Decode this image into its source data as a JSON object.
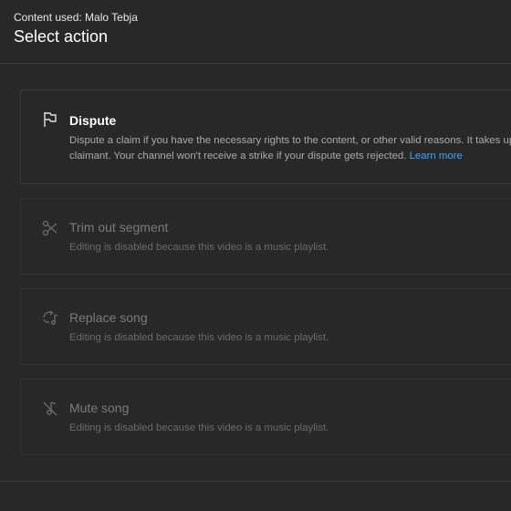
{
  "header": {
    "content_used": "Content used: Malo Tebja",
    "title": "Select action"
  },
  "actions": [
    {
      "label": "Dispute",
      "icon": "flag-icon",
      "enabled": true,
      "description_line1": "Dispute a claim if you have the necessary rights to the content, or other valid reasons. It takes up",
      "description_line2": "claimant. Your channel won't receive a strike if your dispute gets rejected.",
      "learn_more": "Learn more"
    },
    {
      "label": "Trim out segment",
      "icon": "scissors-icon",
      "enabled": false,
      "description": "Editing is disabled because this video is a music playlist."
    },
    {
      "label": "Replace song",
      "icon": "replace-music-icon",
      "enabled": false,
      "description": "Editing is disabled because this video is a music playlist."
    },
    {
      "label": "Mute song",
      "icon": "mute-music-icon",
      "enabled": false,
      "description": "Editing is disabled because this video is a music playlist."
    }
  ],
  "colors": {
    "background": "#282828",
    "link": "#3ea6ff",
    "disabled_text": "#7a7a7a"
  }
}
